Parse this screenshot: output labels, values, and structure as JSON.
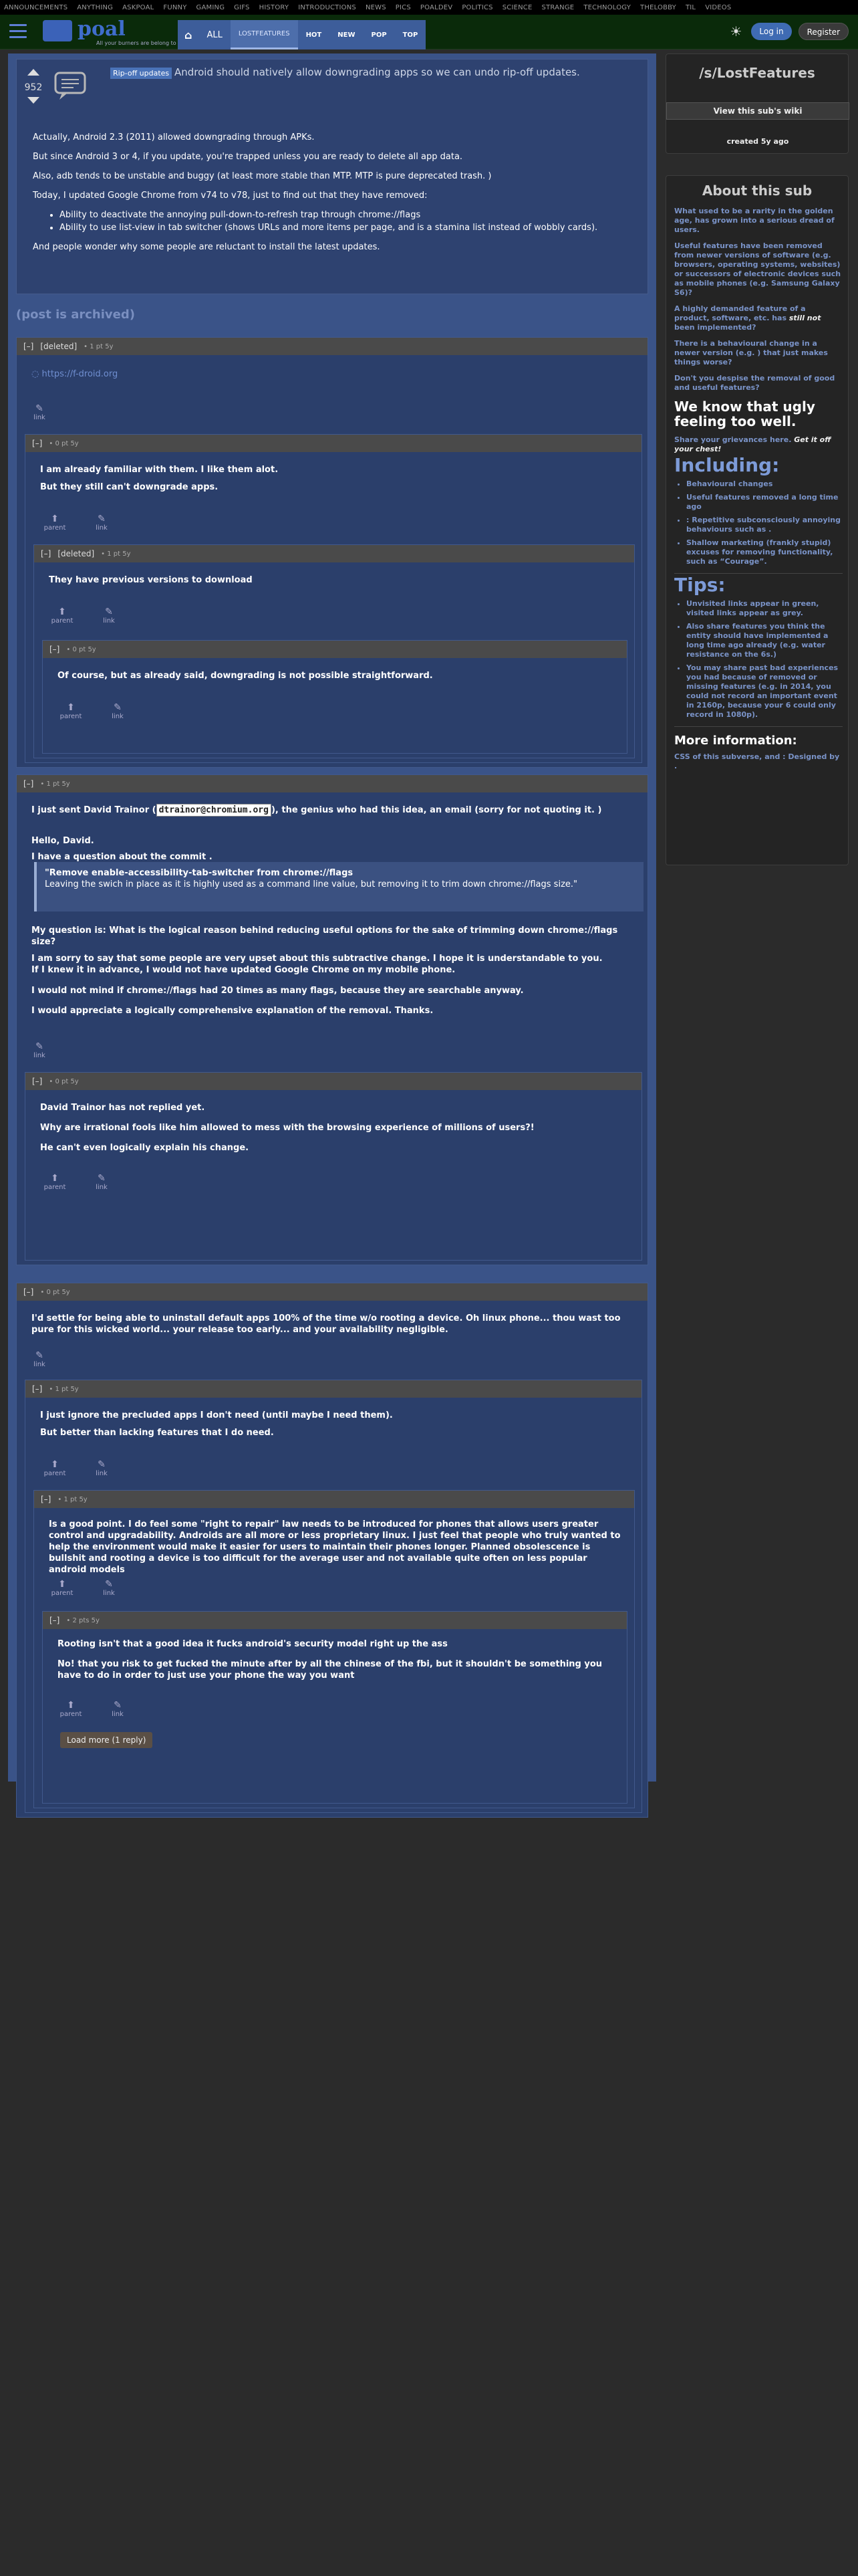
{
  "topnav": [
    "ANNOUNCEMENTS",
    "ANYTHING",
    "ASKPOAL",
    "FUNNY",
    "GAMING",
    "GIFS",
    "HISTORY",
    "INTRODUCTIONS",
    "NEWS",
    "PICS",
    "POALDEV",
    "POLITICS",
    "SCIENCE",
    "STRANGE",
    "TECHNOLOGY",
    "THELOBBY",
    "TIL",
    "VIDEOS"
  ],
  "header": {
    "logo_text": "poal",
    "tagline": "All your burners are belong to us",
    "tabs": {
      "all": "ALL",
      "lostfeatures": "LOSTFEATURES",
      "hot": "HOT",
      "new": "NEW",
      "pop": "POP",
      "top": "TOP"
    },
    "login": "Log in",
    "register": "Register"
  },
  "post": {
    "score": "952",
    "flair": "Rip-off updates",
    "title": "Android should natively allow downgrading apps so we can undo rip-off updates.",
    "p1": "Actually, Android 2.3 (2011) allowed downgrading through APKs.",
    "p2": "But since Android 3 or 4, if you update, you're trapped unless you are ready to delete all app data.",
    "p3": "Also, adb tends to be unstable and buggy (at least more stable than MTP. MTP is pure deprecated trash. )",
    "p4": "Today, I updated Google Chrome from v74 to v78, just to find out that they have removed:",
    "li1": "Ability to deactivate the annoying pull-down-to-refresh trap through chrome://flags",
    "li2": "Ability to use list-view in tab switcher (shows URLs and more items per page, and is a stamina list instead of wobbly cards).",
    "p5": "And people wonder why some people are reluctant to install the latest updates."
  },
  "archived": "(post is archived)",
  "actions": {
    "link": "link",
    "parent": "parent",
    "toggle": "[–]"
  },
  "comments": {
    "c1": {
      "user": "[deleted]",
      "meta": "• 1 pt 5y",
      "body": "https://f-droid.org"
    },
    "c2": {
      "meta": "• 0 pt 5y",
      "l1": "I am already familiar with them. I like them alot.",
      "l2": "But they still can't downgrade apps."
    },
    "c3": {
      "user": "[deleted]",
      "meta": "• 1 pt 5y",
      "body": "They have previous versions to download"
    },
    "c4": {
      "meta": "• 0 pt 5y",
      "body": "Of course, but as already said, downgrading is not possible straightforward."
    },
    "c5": {
      "meta": "• 1 pt 5y",
      "line_a": "I just sent David Trainor (",
      "email": "dtrainor@chromium.org",
      "line_b": "), the genius who had this idea, an email (sorry for not quoting it. )",
      "hello": "Hello, David.",
      "q1": "I have a question about the commit .",
      "quote1": "\"Remove enable-accessibility-tab-switcher from chrome://flags",
      "quote2": "Leaving the swich in place as it is highly used as a command line value, but removing it to trim down chrome://flags size.\"",
      "p1": "My question is: What is the logical reason behind reducing useful options for the sake of trimming down chrome://flags size?",
      "p2a": "I am sorry to say that some people are very upset about this subtractive change. I hope it is understandable to you.",
      "p2b": "If I knew it in advance, I would not have updated Google Chrome on my mobile phone.",
      "p3": "I would not mind if chrome://flags had 20 times as many flags, because they are searchable anyway.",
      "p4": "I would appreciate a logically comprehensive explanation of the removal. Thanks."
    },
    "c6": {
      "meta": "• 0 pt 5y",
      "l1": "David Trainor has not replied yet.",
      "l2": "Why are irrational fools like him allowed to mess with the browsing experience of millions of users?!",
      "l3": "He can't even logically explain his change."
    },
    "c7": {
      "meta": "• 0 pt 5y",
      "body": "I'd settle for being able to uninstall default apps 100% of the time w/o rooting a device. Oh linux phone... thou wast too pure for this wicked world... your release too early... and your availability negligible."
    },
    "c8": {
      "meta": "• 1 pt 5y",
      "l1": "I just ignore the precluded apps I don't need (until maybe I need them).",
      "l2": "But better than lacking features that I do need."
    },
    "c9": {
      "meta": "• 1 pt 5y",
      "body": "Is a good point. I do feel some \"right to repair\" law needs to be introduced for phones that allows users greater control and upgradability. Androids are all more or less proprietary linux. I just feel that people who truly wanted to help the environment would make it easier for users to maintain their phones longer. Planned obsolescence is bullshit and rooting a device is too difficult for the average user and not available quite often on less popular android models"
    },
    "c10": {
      "meta": "• 2 pts 5y",
      "l1": "Rooting isn't that a good idea it fucks android's security model right up the ass",
      "l2": "No! that you risk to get fucked the minute after by all the chinese of the fbi, but it shouldn't be something you have to do in order to just use your phone the way you want"
    },
    "loadmore": "Load more (1 reply)"
  },
  "sidebar": {
    "title": "/s/LostFeatures",
    "wiki": "View this sub's wiki",
    "created": "created 5y ago",
    "about": "About this sub",
    "l1": "What used to be a rarity in the golden age, has grown into a serious dread of users.",
    "l2": "Useful features have been removed from newer versions of software (e.g. browsers, operating systems, websites) or successors of electronic devices such as mobile phones (e.g. Samsung Galaxy S6)?",
    "l3a": "A highly demanded feature of a product, software, etc. has ",
    "l3b": "still not",
    "l3c": " been implemented?",
    "l4": "There is a behavioural change in a newer version (e.g. ) that just makes things worse?",
    "l5": "Don't you despise the removal of good and useful features?",
    "ugly": "We know that ugly feeling too well.",
    "share_a": "Share your grievances here. ",
    "share_b": "Get it off your chest!",
    "including": "Including:",
    "inc": [
      "Behavioural changes",
      "Useful features removed a long time ago",
      ": Repetitive subconsciously annoying behaviours such as .",
      "Shallow marketing (frankly stupid) excuses for removing functionality, such as “Courage”."
    ],
    "tips": "Tips:",
    "tip": [
      "Unvisited links appear in green, visited links appear as grey.",
      "Also share features you think the entity should have implemented a long time ago already (e.g. water resistance on the 6s.)",
      "You may share past bad experiences you had because of removed or missing features (e.g. in 2014, you could not record an important event in 2160p, because your 6 could only record in 1080p)."
    ],
    "more": "More information:",
    "css": "CSS of this subverse, and : Designed by ."
  }
}
